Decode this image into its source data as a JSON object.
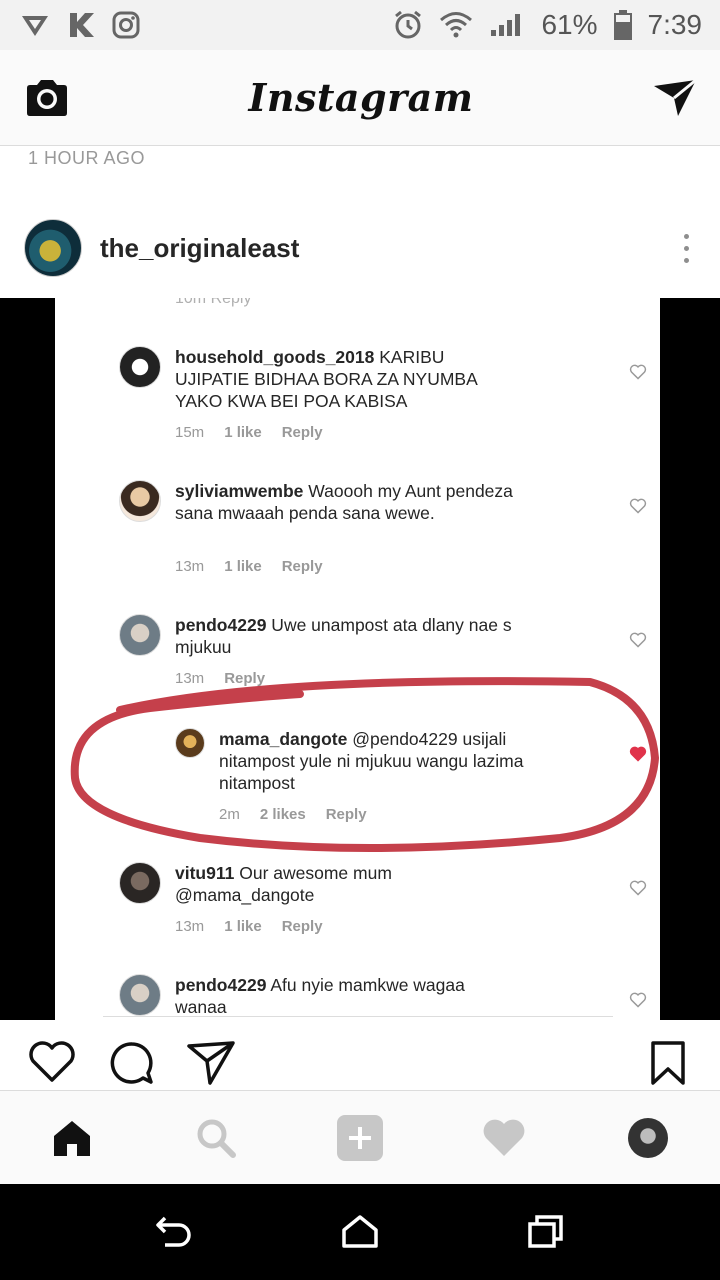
{
  "status_bar": {
    "battery": "61%",
    "time": "7:39"
  },
  "app": {
    "logo": "Instagram"
  },
  "post": {
    "time_ago": "1 HOUR AGO",
    "username": "the_originaleast",
    "partial_top_text": "10m      Reply",
    "comments": [
      {
        "user": "household_goods_2018",
        "text": " KARIBU UJIPATIE BIDHAA BORA ZA NYUMBA YAKO KWA BEI POA KABISA",
        "time": "15m",
        "likes": "1 like",
        "reply": "Reply",
        "liked": false
      },
      {
        "user": "syliviamwembe",
        "text": " Waoooh my Aunt pendeza sana mwaaah penda sana wewe.",
        "time": "13m",
        "likes": "1 like",
        "reply": "Reply",
        "liked": false
      },
      {
        "user": "pendo4229",
        "text": " Uwe unampost ata dlany nae s mjukuu",
        "time": "13m",
        "likes": "",
        "reply": "Reply",
        "liked": false
      },
      {
        "user": "mama_dangote",
        "text": " @pendo4229 usijali nitampost yule ni mjukuu wangu lazima nitampost",
        "time": "2m",
        "likes": "2 likes",
        "reply": "Reply",
        "liked": true
      },
      {
        "user": "vitu911",
        "text": " Our awesome mum @mama_dangote",
        "time": "13m",
        "likes": "1 like",
        "reply": "Reply",
        "liked": false
      },
      {
        "user": "pendo4229",
        "text": " Afu nyie mamkwe wagaa wanaa",
        "time": "",
        "likes": "",
        "reply": "",
        "liked": false
      }
    ]
  },
  "colors": {
    "accent_red": "#e0334a",
    "annotation_red": "#c0303c"
  }
}
